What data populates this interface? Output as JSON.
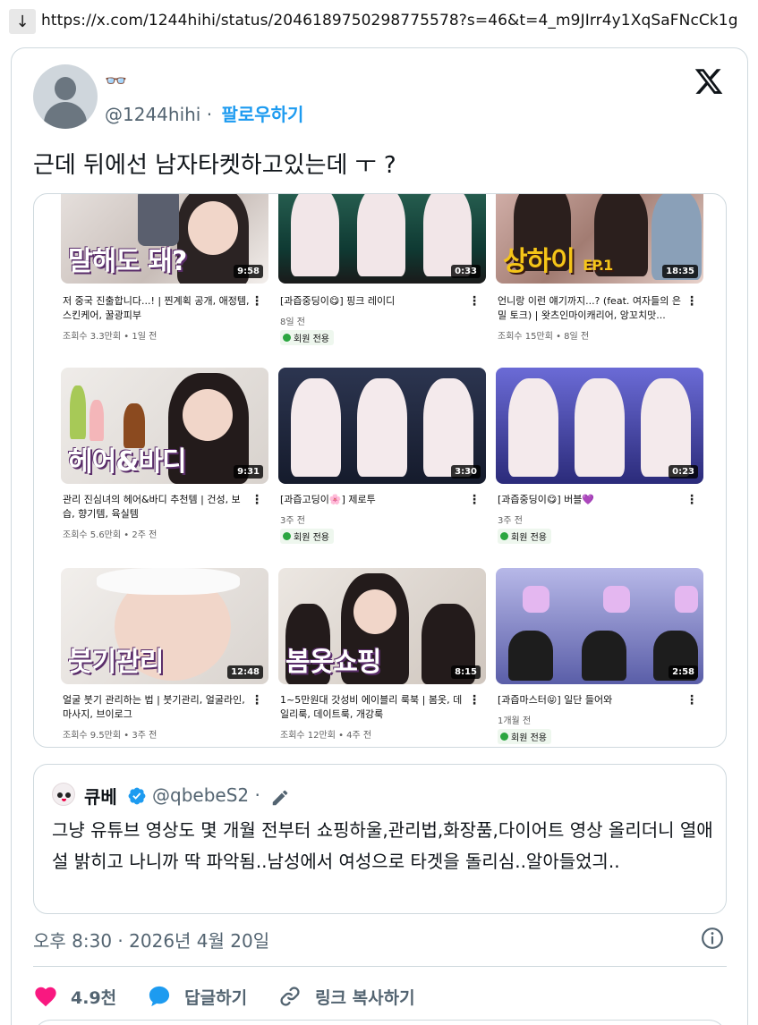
{
  "browser": {
    "download_glyph": "↓",
    "url": "https://x.com/1244hihi/status/2046189750298775578?s=46&t=4_m9JIrr4y1XqSaFNcCk1g"
  },
  "tweet": {
    "display_name": "👓",
    "handle": "@1244hihi",
    "separator": "·",
    "follow_label": "팔로우하기",
    "text": "근데 뒤에선 남자타켓하고있는데 ㅜ ?",
    "timestamp": "오후 8:30 · 2026년 4월 20일"
  },
  "videos": [
    {
      "title": "저 중국 진출합니다...! | 찐계획 공개, 애정템, 스킨케어, 꿀광피부",
      "thumb_text": "말해도 돼?",
      "duration": "9:58",
      "meta": "조회수 3.3만회 • 1일 전",
      "member": ""
    },
    {
      "title": "[과즙중딩이😋] 핑크 레이디",
      "thumb_text": "",
      "duration": "0:33",
      "meta": "8일 전",
      "member": "회원 전용"
    },
    {
      "title": "언니랑 이런 얘기까지...? (feat. 여자들의 은밀 토크) | 왓츠인마이캐리어, 앙꼬치맛...",
      "thumb_text": "상하이",
      "thumb_sub": "EP.1",
      "duration": "18:35",
      "meta": "조회수 15만회 • 8일 전",
      "member": ""
    },
    {
      "title": "관리 진심녀의 헤어&바디 추천템 | 건성, 보습, 향기템, 육실템",
      "thumb_text": "헤어&바디",
      "duration": "9:31",
      "meta": "조회수 5.6만회 • 2주 전",
      "member": ""
    },
    {
      "title": "[과즙고딩이🌸] 제로투",
      "thumb_text": "",
      "duration": "3:30",
      "meta": "3주 전",
      "member": "회원 전용"
    },
    {
      "title": "[과즙중딩이😋] 버블💜",
      "thumb_text": "",
      "duration": "0:23",
      "meta": "3주 전",
      "member": "회원 전용"
    },
    {
      "title": "얼굴 붓기 관리하는 법 | 붓기관리, 얼굴라인, 마사지, 브이로그",
      "thumb_text": "붓기관리",
      "duration": "12:48",
      "meta": "조회수 9.5만회 • 3주 전",
      "member": ""
    },
    {
      "title": "1~5만원대 갓성비 에이블리 룩북 | 봄옷, 데일리룩, 데이트룩, 개강룩",
      "thumb_text": "봄옷쇼핑",
      "duration": "8:15",
      "meta": "조회수 12만회 • 4주 전",
      "member": ""
    },
    {
      "title": "[과즙마스터😝] 일단 들어와",
      "thumb_text": "",
      "duration": "2:58",
      "meta": "1개월 전",
      "member": "회원 전용"
    }
  ],
  "quote": {
    "name": "큐베",
    "handle": "@qbebeS2",
    "separator": "·",
    "text": "그냥 유튜브 영상도 몇 개월 전부터 쇼핑하울,관리법,화장품,다이어트 영상 올리더니 열애설 밝히고 나니까 딱 파악됨..남성에서 여성으로 타겟을 돌리심..알아들었긔.."
  },
  "actions": {
    "like_count": "4.9천",
    "reply_label": "답글하기",
    "copy_label": "링크 복사하기"
  },
  "colors": {
    "accent": "#1d9bf0",
    "like": "#f91880",
    "muted": "#536471",
    "border": "#cfd9de"
  },
  "icons": [
    "download-icon",
    "x-logo-icon",
    "verified-icon",
    "pencil-icon",
    "info-icon",
    "heart-icon",
    "reply-icon",
    "link-icon",
    "more-dots-icon"
  ]
}
